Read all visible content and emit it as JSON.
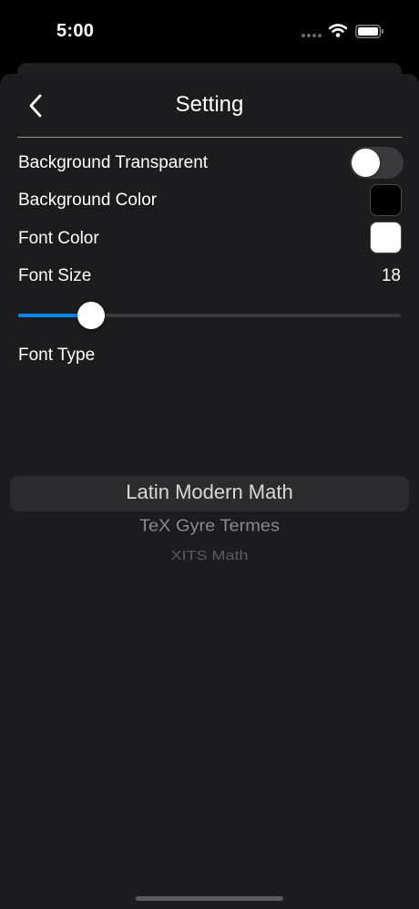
{
  "status_bar": {
    "time": "5:00",
    "icons": [
      "cellular-dots-icon",
      "wifi-icon",
      "battery-icon"
    ]
  },
  "nav": {
    "title": "Setting",
    "back_icon": "chevron-left-icon"
  },
  "settings": {
    "background_transparent": {
      "label": "Background Transparent",
      "enabled": false
    },
    "background_color": {
      "label": "Background Color",
      "color": "#000000"
    },
    "font_color": {
      "label": "Font Color",
      "color": "#ffffff"
    },
    "font_size": {
      "label": "Font Size",
      "value": "18",
      "slider_fraction": 0.19
    },
    "font_type": {
      "label": "Font Type",
      "options": [
        "Latin Modern Math",
        "TeX Gyre Termes",
        "XITS Math"
      ],
      "selected": "Latin Modern Math"
    }
  },
  "colors": {
    "accent": "#0a84ff",
    "sheet_background": "#1c1c1e",
    "toggle_off": "#3a3a3c"
  }
}
